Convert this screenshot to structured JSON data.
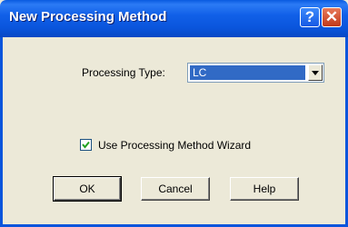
{
  "window": {
    "title": "New Processing Method",
    "help_glyph": "?",
    "close_glyph": "✕"
  },
  "form": {
    "processing_type_label": "Processing Type:",
    "processing_type_value": "LC",
    "wizard_checkbox_label": "Use Processing Method Wizard",
    "wizard_checked": true
  },
  "buttons": {
    "ok": "OK",
    "cancel": "Cancel",
    "help": "Help"
  },
  "colors": {
    "titlebar": "#0A55DC",
    "dialog_bg": "#ECE9D8",
    "selection": "#316AC5"
  }
}
